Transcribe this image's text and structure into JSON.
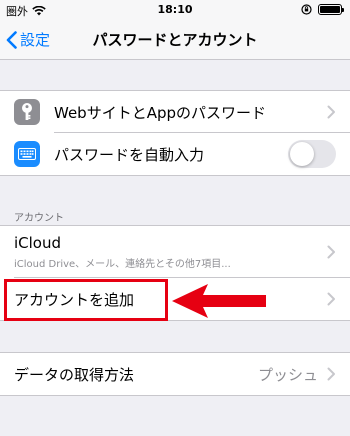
{
  "status_bar": {
    "carrier": "圏外",
    "time": "18:10"
  },
  "nav": {
    "back_label": "設定",
    "title": "パスワードとアカウント"
  },
  "passwords_section": {
    "items": [
      {
        "label": "WebサイトとAppのパスワード",
        "icon": "key-icon"
      },
      {
        "label": "パスワードを自動入力",
        "icon": "keyboard-icon",
        "toggle_on": false
      }
    ]
  },
  "accounts_section": {
    "header": "アカウント",
    "icloud": {
      "title": "iCloud",
      "subtitle": "iCloud Drive、メール、連絡先とその他7項目..."
    },
    "add_account_label": "アカウントを追加"
  },
  "fetch_section": {
    "label": "データの取得方法",
    "value": "プッシュ"
  },
  "annotations": {
    "highlight_color": "#e60012",
    "arrow_color": "#e60012"
  },
  "colors": {
    "accent": "#007aff",
    "background": "#efeff4"
  }
}
